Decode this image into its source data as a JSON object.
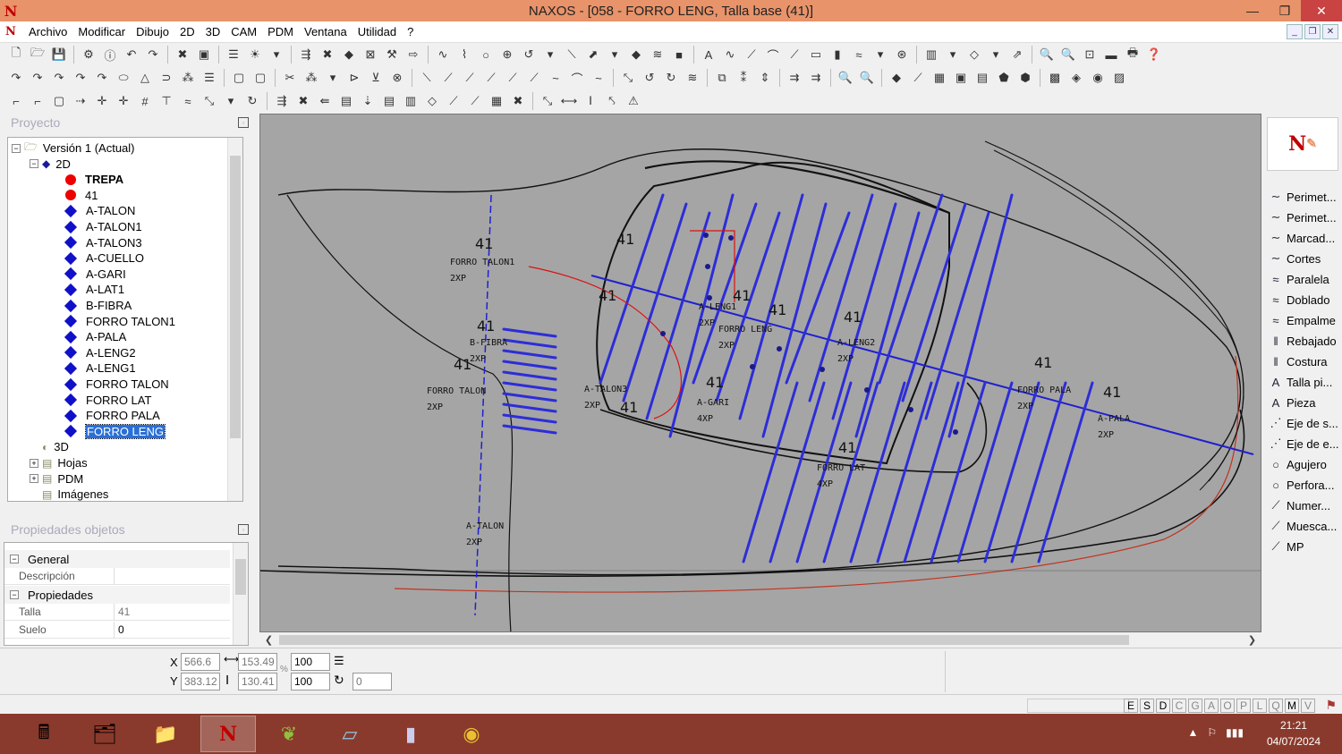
{
  "window": {
    "title": "NAXOS - [058 - FORRO LENG, Talla base (41)]",
    "app_logo": "N",
    "buttons": [
      "—",
      "❐",
      "✕"
    ]
  },
  "menu": {
    "items": [
      "Archivo",
      "Modificar",
      "Dibujo",
      "2D",
      "3D",
      "CAM",
      "PDM",
      "Ventana",
      "Utilidad",
      "?"
    ]
  },
  "project_panel": {
    "title": "Proyecto",
    "tree": [
      {
        "label": "Versión 1 (Actual)",
        "level": 0,
        "icon": "version-icon",
        "expander": "−"
      },
      {
        "label": "2D",
        "level": 1,
        "icon": "folder-2d-icon",
        "expander": "−"
      },
      {
        "label": "TREPA",
        "level": 2,
        "icon": "red-dot",
        "bold": true
      },
      {
        "label": "41",
        "level": 2,
        "icon": "red-dot"
      },
      {
        "label": "A-TALON",
        "level": 2,
        "icon": "blue-diamond"
      },
      {
        "label": "A-TALON1",
        "level": 2,
        "icon": "blue-diamond"
      },
      {
        "label": "A-TALON3",
        "level": 2,
        "icon": "blue-diamond"
      },
      {
        "label": "A-CUELLO",
        "level": 2,
        "icon": "blue-diamond"
      },
      {
        "label": "A-GARI",
        "level": 2,
        "icon": "blue-diamond"
      },
      {
        "label": "A-LAT1",
        "level": 2,
        "icon": "blue-diamond"
      },
      {
        "label": "B-FIBRA",
        "level": 2,
        "icon": "blue-diamond"
      },
      {
        "label": "FORRO TALON1",
        "level": 2,
        "icon": "blue-diamond"
      },
      {
        "label": "A-PALA",
        "level": 2,
        "icon": "blue-diamond"
      },
      {
        "label": "A-LENG2",
        "level": 2,
        "icon": "blue-diamond"
      },
      {
        "label": "A-LENG1",
        "level": 2,
        "icon": "blue-diamond"
      },
      {
        "label": "FORRO TALON",
        "level": 2,
        "icon": "blue-diamond"
      },
      {
        "label": "FORRO LAT",
        "level": 2,
        "icon": "blue-diamond"
      },
      {
        "label": "FORRO PALA",
        "level": 2,
        "icon": "blue-diamond"
      },
      {
        "label": "FORRO LENG",
        "level": 2,
        "icon": "blue-diamond",
        "selected": true
      },
      {
        "label": "3D",
        "level": 1,
        "icon": "globe-3d-icon"
      },
      {
        "label": "Hojas",
        "level": 1,
        "icon": "sheets-icon",
        "expander": "+"
      },
      {
        "label": "PDM",
        "level": 1,
        "icon": "folder-icon",
        "expander": "+"
      },
      {
        "label": "Imágenes",
        "level": 1,
        "icon": "images-icon"
      }
    ]
  },
  "properties_panel": {
    "title": "Propiedades objetos",
    "categories": [
      {
        "label": "General",
        "rows": [
          {
            "key": "Descripción",
            "value": ""
          }
        ]
      },
      {
        "label": "Propiedades",
        "rows": [
          {
            "key": "Talla",
            "value": "41"
          },
          {
            "key": "Suelo",
            "value": "0"
          }
        ]
      }
    ]
  },
  "right_panel": {
    "tools": [
      {
        "icon": "perimeter-icon",
        "glyph": "∼",
        "label": "Perimet..."
      },
      {
        "icon": "perimeter2-icon",
        "glyph": "∼",
        "label": "Perimet..."
      },
      {
        "icon": "mark-icon",
        "glyph": "∼",
        "label": "Marcad..."
      },
      {
        "icon": "cuts-icon",
        "glyph": "∼",
        "label": "Cortes"
      },
      {
        "icon": "parallel-icon",
        "glyph": "≈",
        "label": "Paralela"
      },
      {
        "icon": "fold-icon",
        "glyph": "≈",
        "label": "Doblado"
      },
      {
        "icon": "joint-icon",
        "glyph": "≈",
        "label": "Empalme"
      },
      {
        "icon": "skive-icon",
        "glyph": "‖",
        "label": "Rebajado"
      },
      {
        "icon": "seam-icon",
        "glyph": "‖",
        "label": "Costura"
      },
      {
        "icon": "text-size-icon",
        "glyph": "A",
        "label": "Talla pi..."
      },
      {
        "icon": "piece-icon",
        "glyph": "A",
        "label": "Pieza"
      },
      {
        "icon": "axis-icon",
        "glyph": "⋰",
        "label": "Eje de s..."
      },
      {
        "icon": "axis2-icon",
        "glyph": "⋰",
        "label": "Eje de e..."
      },
      {
        "icon": "hole-icon",
        "glyph": "○",
        "label": "Agujero"
      },
      {
        "icon": "perforation-icon",
        "glyph": "○",
        "label": "Perfora..."
      },
      {
        "icon": "numbering-icon",
        "glyph": "⟋",
        "label": "Numer..."
      },
      {
        "icon": "notch-icon",
        "glyph": "⟋",
        "label": "Muesca..."
      },
      {
        "icon": "mp-icon",
        "glyph": "⟋",
        "label": "MP"
      }
    ]
  },
  "canvas_labels": [
    {
      "t": "FORRO TALON1",
      "n": "2XP"
    },
    {
      "t": "B-FIBRA",
      "n": "2XP"
    },
    {
      "t": "FORRO TALON",
      "n": "2XP"
    },
    {
      "t": "A-TALON3",
      "n": "2XP"
    },
    {
      "t": "A-LENG1",
      "n": "2XP"
    },
    {
      "t": "FORRO LENG",
      "n": "2XP"
    },
    {
      "t": "A-LENG2",
      "n": "2XP"
    },
    {
      "t": "A-GARI",
      "n": "4XP"
    },
    {
      "t": "FORRO LAT",
      "n": "4XP"
    },
    {
      "t": "FORRO PALA",
      "n": "2XP"
    },
    {
      "t": "A-PALA",
      "n": "2XP"
    },
    {
      "t": "A-TALON",
      "n": "2XP"
    }
  ],
  "size_marks": [
    "41",
    "41",
    "41",
    "41",
    "41",
    "41",
    "41",
    "41",
    "41",
    "41",
    "41",
    "41",
    "41"
  ],
  "coordinates": {
    "x_label": "X",
    "y_label": "Y",
    "x": "566.6",
    "y": "383.12",
    "w": "153.49",
    "h": "130.41",
    "scale_x": "100",
    "scale_y": "100",
    "rotation": "0",
    "pct": "%"
  },
  "status_letters": [
    "E",
    "S",
    "D",
    "C",
    "G",
    "A",
    "O",
    "P",
    "L",
    "Q",
    "M",
    "V"
  ],
  "status_on": [
    "E",
    "S",
    "D",
    "M"
  ],
  "taskbar": {
    "apps": [
      "calculator-icon",
      "explorer-icon",
      "files-icon",
      "naxos-icon",
      "plants-icon",
      "book-icon",
      "tool-icon",
      "chrome-icon"
    ],
    "time": "21:21",
    "date": "04/07/2024"
  },
  "colors": {
    "titlebar": "#e8936a",
    "canvas": "#a5a5a5",
    "selection": "#2a6fd6",
    "taskbar": "#8a3a2c",
    "pattern_blue": "#2d2dd8",
    "pattern_red": "#d11"
  }
}
